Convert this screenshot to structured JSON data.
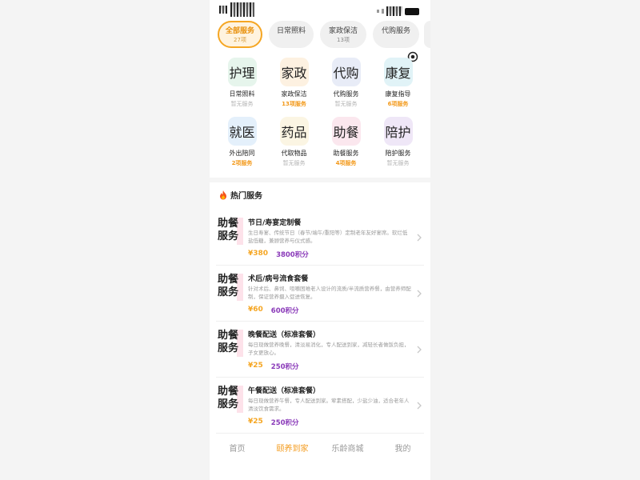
{
  "tabs": [
    {
      "label": "全部服务",
      "count": "27项",
      "active": true
    },
    {
      "label": "日常照料",
      "count": ""
    },
    {
      "label": "家政保洁",
      "count": "13项"
    },
    {
      "label": "代购服务",
      "count": ""
    }
  ],
  "grid": [
    {
      "tile": "护理",
      "name": "日常照料",
      "sub": "暂无服务",
      "color": "#e6f5ec"
    },
    {
      "tile": "家政",
      "name": "家政保洁",
      "sub": "13项服务",
      "color": "#fdf1e1"
    },
    {
      "tile": "代购",
      "name": "代购服务",
      "sub": "暂无服务",
      "color": "#e8ecf7"
    },
    {
      "tile": "康复",
      "name": "康复指导",
      "sub": "6项服务",
      "color": "#e1f3f7"
    },
    {
      "tile": "就医",
      "name": "外出陪同",
      "sub": "2项服务",
      "color": "#e4f0fb"
    },
    {
      "tile": "药品",
      "name": "代取物品",
      "sub": "暂无服务",
      "color": "#fbf5e3"
    },
    {
      "tile": "助餐",
      "name": "助餐服务",
      "sub": "4项服务",
      "color": "#fbe7ee"
    },
    {
      "tile": "陪护",
      "name": "陪护服务",
      "sub": "暂无服务",
      "color": "#efe7f7"
    }
  ],
  "hot": {
    "title": "热门服务",
    "items": [
      {
        "thumb_line1": "助餐",
        "thumb_line2": "服务",
        "title": "节日/寿宴定制餐",
        "desc": "生日寿宴、传统节日（春节/端午/重阳等）定制老年友好宴席。软烂低盐低糖，兼顾营养与仪式感。",
        "price": "¥380",
        "points": "3800积分"
      },
      {
        "thumb_line1": "助餐",
        "thumb_line2": "服务",
        "title": "术后/病号流食套餐",
        "desc": "针对术后、鼻饲、咀嚼困难老人设计的流质/半流质营养餐，由营养师配制，保证营养摄入促进恢复。",
        "price": "¥60",
        "points": "600积分"
      },
      {
        "thumb_line1": "助餐",
        "thumb_line2": "服务",
        "title": "晚餐配送（标准套餐）",
        "desc": "每日现做营养晚餐，清淡易消化，专人配送到家，减轻长者做饭负担，子女更放心。",
        "price": "¥25",
        "points": "250积分"
      },
      {
        "thumb_line1": "助餐",
        "thumb_line2": "服务",
        "title": "午餐配送（标准套餐）",
        "desc": "每日现做营养午餐，专人配送到家。荤素搭配，少盐少油，适合老年人清淡饮食需求。",
        "price": "¥25",
        "points": "250积分"
      }
    ]
  },
  "nav": [
    {
      "label": "首页",
      "active": false
    },
    {
      "label": "颐养到家",
      "active": true
    },
    {
      "label": "乐龄商城",
      "active": false
    },
    {
      "label": "我的",
      "active": false
    }
  ],
  "colors": {
    "accent": "#f5a623",
    "points": "#8a3ab9"
  }
}
